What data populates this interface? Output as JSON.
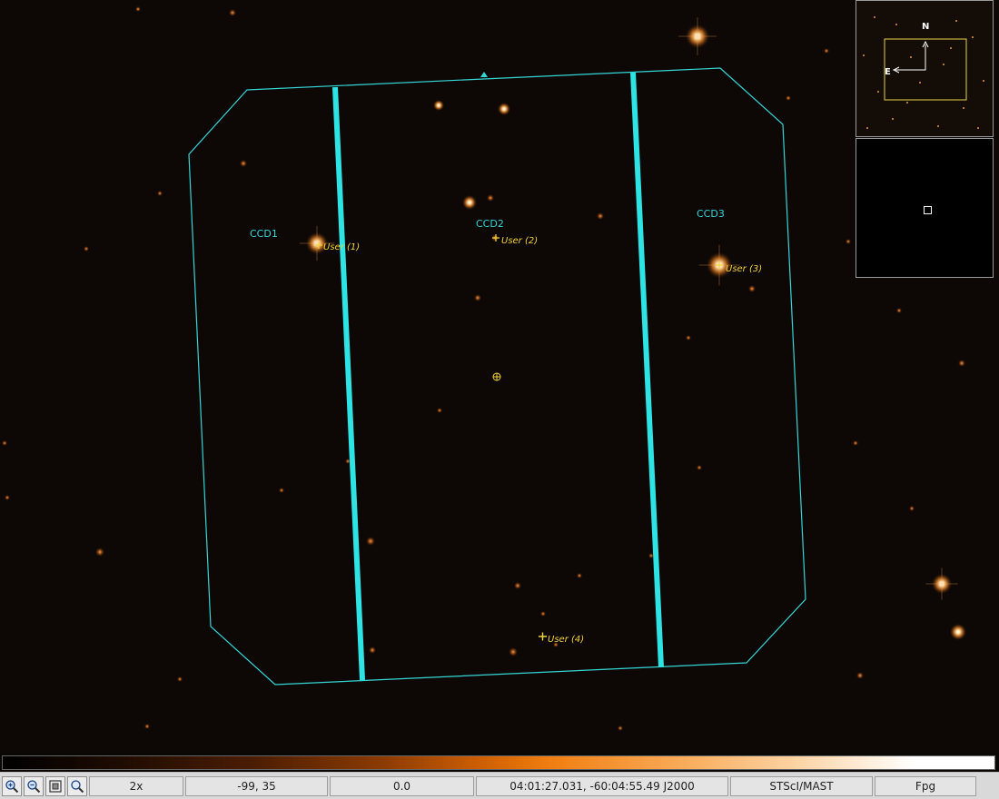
{
  "fov": {
    "labels": [
      "CCD1",
      "CCD2",
      "CCD3"
    ],
    "markers": [
      "User (1)",
      "User (2)",
      "User (3)",
      "User (4)"
    ]
  },
  "panner": {
    "north": "N",
    "east": "E"
  },
  "status": {
    "zoom": "2x",
    "pixel": "-99, 35",
    "value": "0.0",
    "coords": "04:01:27.031, -60:04:55.49 J2000",
    "server": "STScI/MAST",
    "filter": "Fpg"
  },
  "icons": [
    "zoom-in-icon",
    "zoom-out-icon",
    "zoom-fit-icon",
    "magnifier-icon"
  ],
  "colors": {
    "fov": "#35d6d6",
    "marker": "#f2d23a",
    "star": "#ffb15a"
  }
}
